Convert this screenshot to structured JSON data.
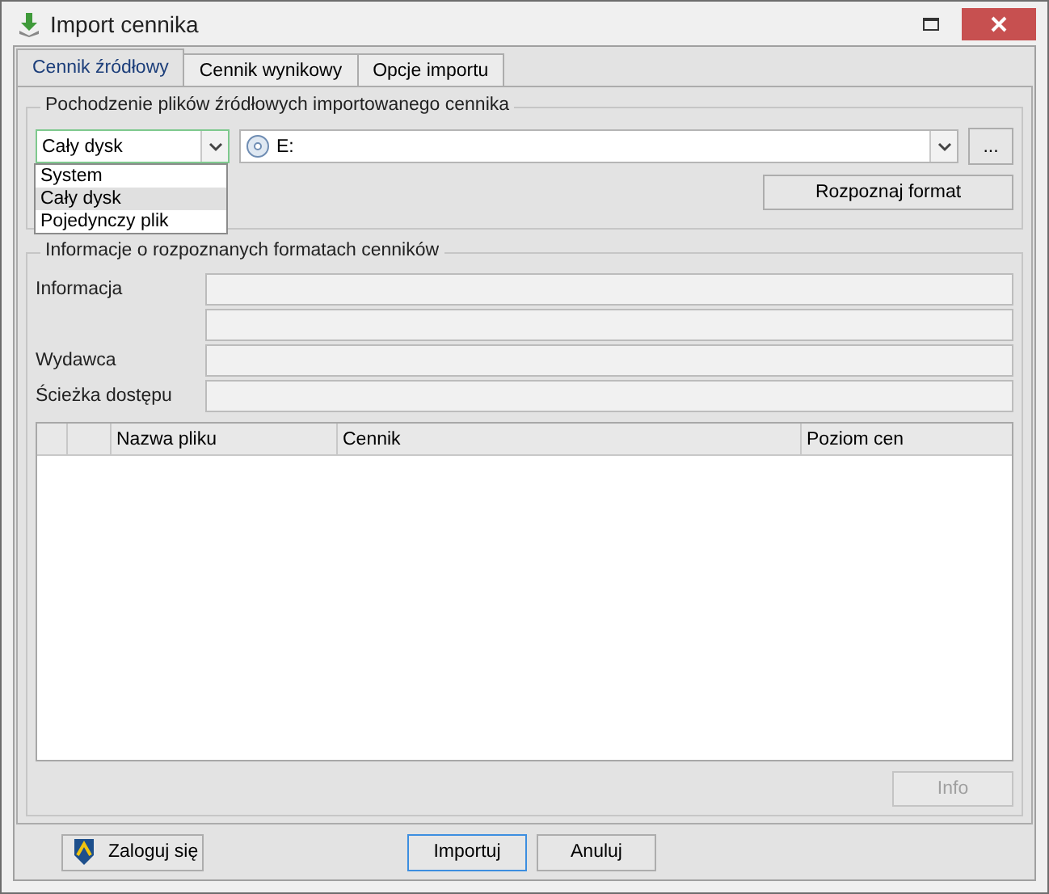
{
  "window": {
    "title": "Import cennika"
  },
  "tabs": [
    {
      "label": "Cennik źródłowy",
      "selected": true
    },
    {
      "label": "Cennik wynikowy",
      "selected": false
    },
    {
      "label": "Opcje importu",
      "selected": false
    }
  ],
  "source_group": {
    "title": "Pochodzenie plików źródłowych importowanego cennika",
    "source_type": {
      "value": "Cały dysk",
      "expanded": true,
      "options": [
        {
          "label": "System",
          "selected": false
        },
        {
          "label": "Cały dysk",
          "selected": true
        },
        {
          "label": "Pojedynczy plik",
          "selected": false
        }
      ]
    },
    "path": {
      "value": "E:"
    },
    "browse_button": "...",
    "detect_button": "Rozpoznaj format"
  },
  "info_group": {
    "title": "Informacje o rozpoznanych formatach cenników",
    "fields": [
      {
        "label": "Informacja",
        "multiline": true
      },
      {
        "label": "Wydawca"
      },
      {
        "label": "Ścieżka dostępu"
      }
    ],
    "table": {
      "columns": [
        "Nazwa pliku",
        "Cennik",
        "Poziom cen"
      ]
    },
    "info_button": {
      "label": "Info",
      "disabled": true
    }
  },
  "footer_buttons": [
    {
      "label": "Zaloguj się",
      "kind": "login"
    },
    {
      "label": "Importuj",
      "kind": "default"
    },
    {
      "label": "Anuluj",
      "kind": "plain"
    }
  ]
}
